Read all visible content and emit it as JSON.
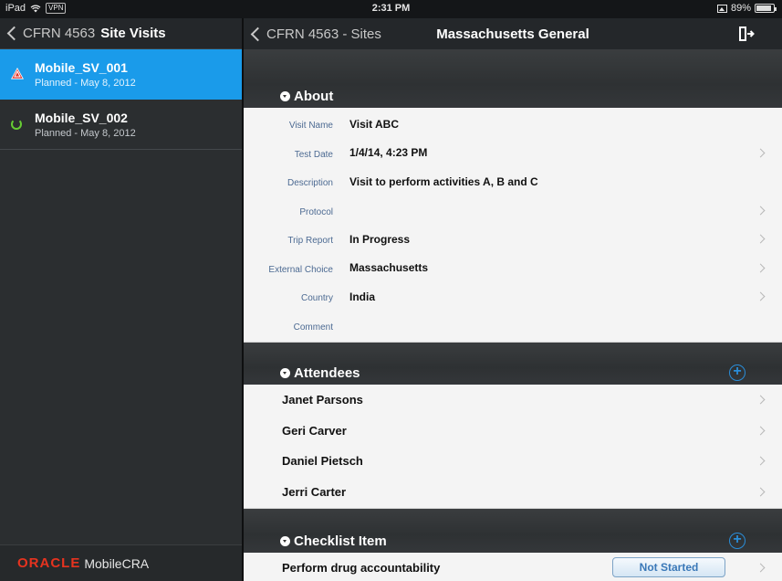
{
  "status_bar": {
    "device": "iPad",
    "vpn": "VPN",
    "time": "2:31 PM",
    "battery": "89%",
    "battery_level": 0.89
  },
  "left_nav": {
    "back_label": "CFRN 4563",
    "title": "Site Visits"
  },
  "visits": [
    {
      "name": "Mobile_SV_001",
      "sub": "Planned - May 8, 2012",
      "icon": "warning-icon"
    },
    {
      "name": "Mobile_SV_002",
      "sub": "Planned - May 8, 2012",
      "icon": "in-progress-icon"
    }
  ],
  "footer": {
    "oracle": "ORACLE",
    "product": "MobileCRA"
  },
  "right_nav": {
    "back_label": "CFRN 4563 - Sites",
    "title": "Massachusetts General"
  },
  "about": {
    "header": "About",
    "fields": [
      {
        "label": "Visit Name",
        "value": "Visit ABC"
      },
      {
        "label": "Test Date",
        "value": "1/4/14, 4:23 PM"
      },
      {
        "label": "Description",
        "value": "Visit to perform activities A, B and C"
      },
      {
        "label": "Protocol",
        "value": ""
      },
      {
        "label": "Trip Report",
        "value": "In Progress"
      },
      {
        "label": "External Choice",
        "value": "Massachusetts"
      },
      {
        "label": "Country",
        "value": "India"
      },
      {
        "label": "Comment",
        "value": ""
      }
    ]
  },
  "attendees": {
    "header": "Attendees",
    "items": [
      "Janet Parsons",
      "Geri Carver",
      "Daniel Pietsch",
      "Jerri Carter"
    ]
  },
  "checklist": {
    "header": "Checklist Item",
    "items": [
      {
        "name": "Perform drug accountability",
        "status": "Not Started"
      }
    ]
  }
}
